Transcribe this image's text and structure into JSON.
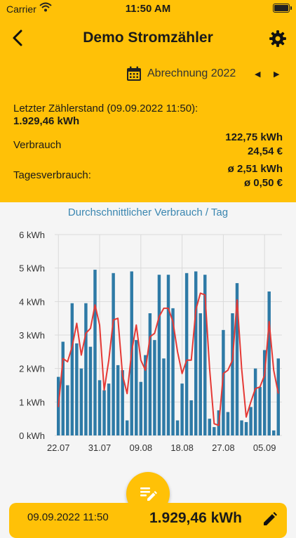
{
  "status": {
    "carrier": "Carrier",
    "time": "11:50 AM"
  },
  "nav": {
    "title": "Demo Stromzähler"
  },
  "period": {
    "label": "Abrechnung 2022"
  },
  "summary": {
    "last_reading_label": "Letzter Zählerstand (09.09.2022 11:50):",
    "last_reading_value": "1.929,46 kWh",
    "consumption_label": "Verbrauch",
    "consumption_kwh": "122,75 kWh",
    "consumption_eur": "24,54 €",
    "daily_label": "Tagesverbrauch:",
    "daily_kwh": "ø 2,51 kWh",
    "daily_eur": "ø 0,50 €"
  },
  "chart_data": {
    "type": "bar",
    "title": "Durchschnittlicher Verbrauch / Tag",
    "ylim": [
      0,
      6
    ],
    "y_ticks": [
      "0 kWh",
      "1 kWh",
      "2 kWh",
      "3 kWh",
      "4 kWh",
      "5 kWh",
      "6 kWh"
    ],
    "x_ticks": [
      "22.07",
      "31.07",
      "09.08",
      "18.08",
      "27.08",
      "05.09"
    ],
    "x_tick_index": [
      0,
      9,
      18,
      27,
      36,
      45
    ],
    "grid": true,
    "bar_color": "#2e7aa6",
    "line_color": "#e53935",
    "series": [
      {
        "type": "bar",
        "values": [
          1.75,
          2.8,
          1.5,
          3.95,
          2.75,
          2.0,
          3.95,
          2.65,
          4.95,
          1.65,
          1.35,
          1.55,
          4.85,
          2.1,
          1.95,
          0.45,
          4.9,
          2.85,
          1.6,
          2.4,
          3.65,
          2.85,
          4.8,
          2.3,
          4.8,
          3.8,
          0.45,
          1.55,
          4.85,
          1.05,
          4.9,
          3.65,
          4.8,
          0.5,
          0.25,
          0.75,
          3.15,
          0.7,
          3.65,
          4.55,
          0.45,
          0.4,
          0.85,
          2.0,
          1.45,
          2.55,
          4.3,
          0.15,
          2.3
        ]
      },
      {
        "type": "line",
        "values": [
          0.85,
          2.3,
          2.2,
          2.65,
          3.35,
          2.4,
          3.05,
          3.2,
          3.9,
          3.3,
          1.35,
          2.25,
          3.45,
          3.5,
          1.8,
          1.25,
          2.5,
          3.3,
          2.25,
          1.95,
          2.95,
          3.05,
          3.55,
          3.8,
          3.8,
          3.4,
          2.5,
          1.85,
          2.25,
          2.25,
          3.75,
          4.25,
          4.2,
          2.0,
          0.35,
          0.3,
          1.85,
          1.95,
          2.25,
          4.05,
          2.0,
          0.55,
          1.0,
          1.4,
          1.45,
          1.8,
          3.4,
          1.95,
          1.25
        ]
      }
    ]
  },
  "latest_entry": {
    "date": "09.09.2022 11:50",
    "value": "1.929,46 kWh"
  }
}
